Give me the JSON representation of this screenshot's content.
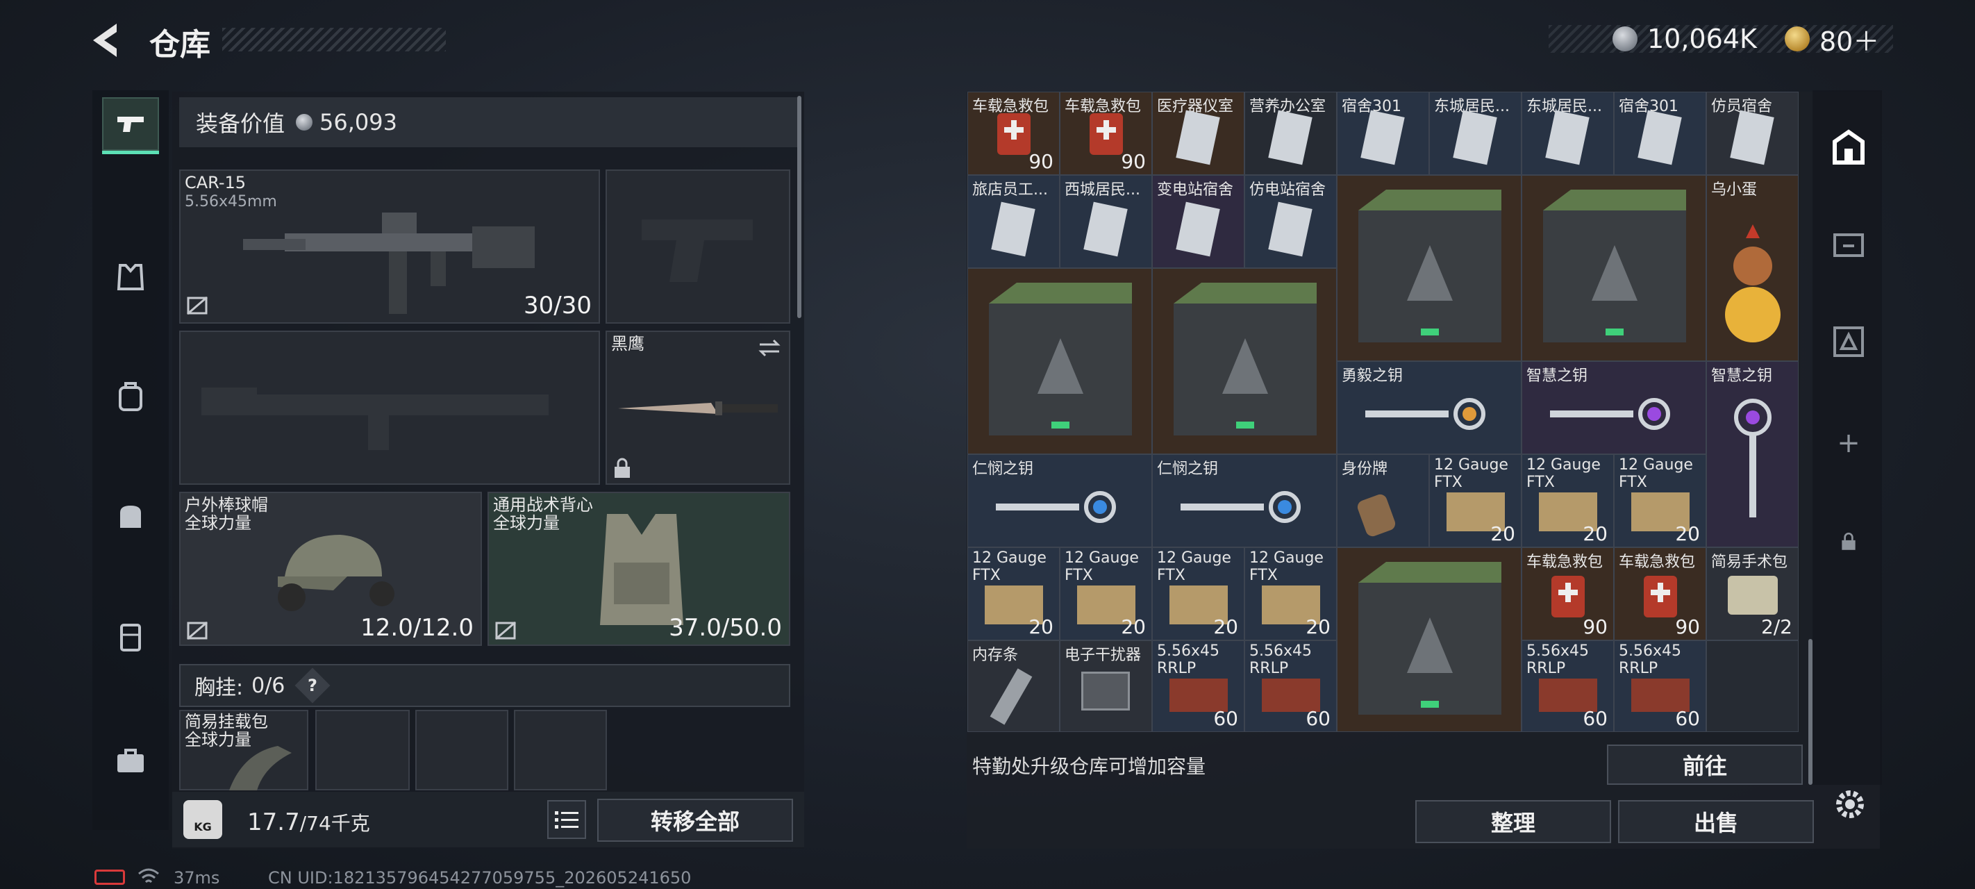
{
  "header": {
    "title": "仓库",
    "silver_amount": "10,064K",
    "gold_amount": "80＋"
  },
  "colors": {
    "accent": "#5ce0b5",
    "blue_cell": "#283344",
    "brown_cell": "#3a2c22",
    "purple_cell": "#2f2a40"
  },
  "left_rail": {
    "icons": [
      "pistol-icon",
      "armor-icon",
      "backpack-icon",
      "bag-icon",
      "locker-icon",
      "toolbox-icon"
    ]
  },
  "equipment": {
    "value_label": "装备价值",
    "value": "56,093",
    "primary": {
      "name": "CAR-15",
      "caliber": "5.56x45mm",
      "ammo": "30/30"
    },
    "melee": {
      "name": "黑鹰"
    },
    "helmet": {
      "name": "户外棒球帽",
      "sub": "全球力量",
      "durability": "12.0/12.0"
    },
    "vest": {
      "name": "通用战术背心",
      "sub": "全球力量",
      "durability": "37.0/50.0"
    },
    "chest_rig": {
      "label": "胸挂:",
      "count": "0/6",
      "help": "?"
    },
    "rig_item": {
      "name": "简易挂载包",
      "sub": "全球力量"
    },
    "weight_value": "17.7",
    "weight_max": "/74千克",
    "weight_badge": "KG",
    "transfer_all": "转移全部"
  },
  "storage": {
    "top_row_labels": [
      "车载急救包",
      "车载急救包",
      "医疗器仪室",
      "营养办公室",
      "宿舍301",
      "东城居民...",
      "东城居民...",
      "宿舍301",
      "仿员宿舍"
    ],
    "cells": [
      {
        "name": "旅店员工...",
        "count": ""
      },
      {
        "name": "西城居民...",
        "count": ""
      },
      {
        "name": "变电站宿舍",
        "count": ""
      },
      {
        "name": "仿电站宿舍",
        "count": ""
      },
      {
        "name": "乌小蛋",
        "count": ""
      },
      {
        "name": "勇毅之钥",
        "count": ""
      },
      {
        "name": "智慧之钥",
        "count": ""
      },
      {
        "name": "智慧之钥",
        "count": ""
      },
      {
        "name": "仁悯之钥",
        "count": ""
      },
      {
        "name": "仁悯之钥",
        "count": ""
      },
      {
        "name": "身份牌",
        "count": ""
      },
      {
        "name": "12 Gauge FTX",
        "count": "20"
      },
      {
        "name": "12 Gauge FTX",
        "count": "20"
      },
      {
        "name": "12 Gauge FTX",
        "count": "20"
      },
      {
        "name": "12 Gauge FTX",
        "count": "20"
      },
      {
        "name": "12 Gauge FTX",
        "count": "20"
      },
      {
        "name": "12 Gauge FTX",
        "count": "20"
      },
      {
        "name": "12 Gauge FTX",
        "count": "20"
      },
      {
        "name": "车载急救包",
        "count": "90"
      },
      {
        "name": "车载急救包",
        "count": "90"
      },
      {
        "name": "简易手术包",
        "count": "2/2"
      },
      {
        "name": "内存条",
        "count": ""
      },
      {
        "name": "电子干扰器",
        "count": ""
      },
      {
        "name": "5.56x45 RRLP",
        "count": "60"
      },
      {
        "name": "5.56x45 RRLP",
        "count": "60"
      },
      {
        "name": "5.56x45 RRLP",
        "count": "60"
      },
      {
        "name": "5.56x45 RRLP",
        "count": "60"
      }
    ],
    "top_counts": [
      "90",
      "90"
    ],
    "hint": "特勤处升级仓库可增加容量",
    "goto_label": "前往",
    "sort_label": "整理",
    "sell_label": "出售"
  },
  "right_rail": {
    "icons": [
      "storage-icon",
      "market-icon",
      "crate-icon",
      "add-icon",
      "lock-icon"
    ],
    "plus": "+"
  },
  "status": {
    "ping": "37ms",
    "uid": "CN UID:18213579645427705975​5_202605241650"
  }
}
